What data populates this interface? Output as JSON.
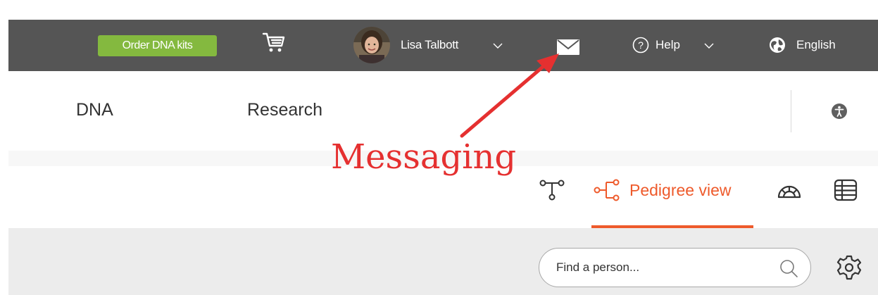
{
  "topbar": {
    "order_button": "Order DNA kits",
    "user_name": "Lisa Talbott",
    "help_label": "Help",
    "language": "English"
  },
  "nav": {
    "items": [
      {
        "label": "DNA"
      },
      {
        "label": "Research"
      }
    ]
  },
  "view_toolbar": {
    "active_view_label": "Pedigree view"
  },
  "search": {
    "placeholder": "Find a person..."
  },
  "annotation": {
    "label": "Messaging"
  },
  "colors": {
    "topbar_bg": "#555555",
    "order_button_bg": "#84b93f",
    "accent": "#ee5a2b",
    "annotation": "#e53030"
  },
  "icons": [
    "cart-icon",
    "avatar",
    "chevron-down-icon",
    "mail-icon",
    "help-icon",
    "globe-icon",
    "accessibility-icon",
    "family-tree-icon",
    "pedigree-icon",
    "fan-view-icon",
    "table-view-icon",
    "search-icon",
    "gear-icon"
  ]
}
